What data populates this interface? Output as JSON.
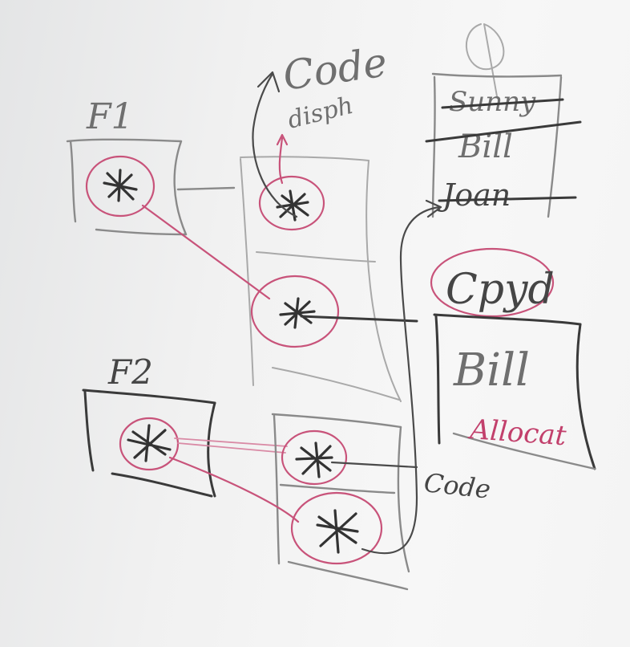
{
  "labels": {
    "frame1": "F1",
    "frame2": "F2",
    "code_title": "Code",
    "code_sub": "disph",
    "class_list": [
      "Sunny",
      "Bill",
      "Joan"
    ],
    "cpyd": "Cpyd",
    "bill": "Bill",
    "allocate": "Allocat",
    "code_bottom": "Code"
  }
}
